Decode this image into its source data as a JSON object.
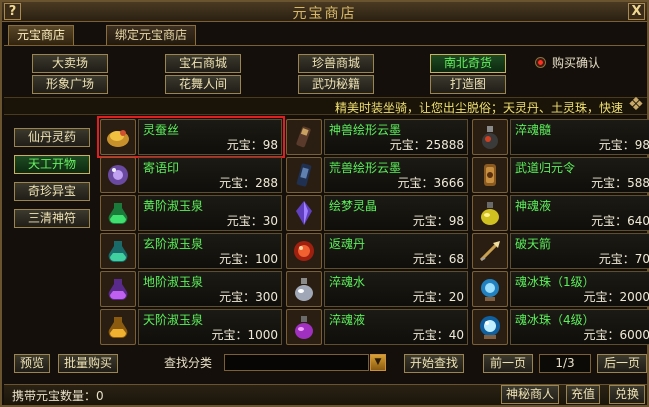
{
  "window": {
    "title": "元宝商店",
    "help_label": "?",
    "close_label": "X"
  },
  "tabs": [
    {
      "label": "元宝商店",
      "active": true
    },
    {
      "label": "绑定元宝商店",
      "active": false
    }
  ],
  "categories": [
    {
      "label": "大卖场",
      "selected": false
    },
    {
      "label": "宝石商城",
      "selected": false
    },
    {
      "label": "珍兽商城",
      "selected": false
    },
    {
      "label": "南北奇货",
      "selected": true
    },
    {
      "label": "形象广场",
      "selected": false
    },
    {
      "label": "花舞人间",
      "selected": false
    },
    {
      "label": "武功秘籍",
      "selected": false
    },
    {
      "label": "打造图",
      "selected": false
    }
  ],
  "buy_confirm": {
    "label": "购买确认",
    "checked": true
  },
  "marquee": "精美时装坐骑，让您出尘脱俗；天灵丹、土灵珠，快速",
  "side_categories": [
    {
      "label": "仙丹灵药",
      "selected": false
    },
    {
      "label": "天工开物",
      "selected": true
    },
    {
      "label": "奇珍异宝",
      "selected": false
    },
    {
      "label": "三清神符",
      "selected": false
    }
  ],
  "price_label": "元宝：",
  "items": [
    {
      "name": "灵蚕丝",
      "price": "98",
      "icon": "silk-icon",
      "highlighted": true
    },
    {
      "name": "神兽绘形云墨",
      "price": "25888",
      "icon": "ink-stick-icon",
      "highlighted": false
    },
    {
      "name": "淬魂髓",
      "price": "98",
      "icon": "bottle-icon",
      "highlighted": false
    },
    {
      "name": "寄语印",
      "price": "288",
      "icon": "seal-icon",
      "highlighted": false
    },
    {
      "name": "荒兽绘形云墨",
      "price": "3666",
      "icon": "ink-block-icon",
      "highlighted": false
    },
    {
      "name": "武道归元令",
      "price": "588",
      "icon": "token-icon",
      "highlighted": false
    },
    {
      "name": "黄阶淑玉泉",
      "price": "30",
      "icon": "green-potion-icon",
      "highlighted": false
    },
    {
      "name": "绘梦灵晶",
      "price": "98",
      "icon": "crystal-icon",
      "highlighted": false
    },
    {
      "name": "神魂液",
      "price": "640",
      "icon": "yellow-flask-icon",
      "highlighted": false
    },
    {
      "name": "玄阶淑玉泉",
      "price": "100",
      "icon": "green-potion-icon",
      "highlighted": false
    },
    {
      "name": "返魂丹",
      "price": "68",
      "icon": "red-pill-icon",
      "highlighted": false
    },
    {
      "name": "破天箭",
      "price": "70",
      "icon": "arrow-icon",
      "highlighted": false
    },
    {
      "name": "地阶淑玉泉",
      "price": "300",
      "icon": "purple-potion-icon",
      "highlighted": false
    },
    {
      "name": "淬魂水",
      "price": "20",
      "icon": "water-flask-icon",
      "highlighted": false
    },
    {
      "name": "魂冰珠（1级）",
      "price": "2000",
      "icon": "ice-orb-icon",
      "highlighted": false
    },
    {
      "name": "天阶淑玉泉",
      "price": "1000",
      "icon": "gold-potion-icon",
      "highlighted": false
    },
    {
      "name": "淬魂液",
      "price": "40",
      "icon": "purple-flask-icon",
      "highlighted": false
    },
    {
      "name": "魂冰珠（4级）",
      "price": "6000",
      "icon": "ice-orb-big-icon",
      "highlighted": false
    }
  ],
  "bottom": {
    "preview_label": "预览",
    "bulk_buy_label": "批量购买",
    "search_label": "查找分类",
    "search_value": "",
    "start_search_label": "开始查找",
    "prev_page_label": "前一页",
    "page": "1/3",
    "next_page_label": "后一页"
  },
  "status": {
    "gold_label": "携带元宝数量：0",
    "mystery_merchant_label": "神秘商人",
    "recharge_label": "充值",
    "exchange_label": "兑换"
  },
  "colors": {
    "item_name": "#5af05a",
    "highlight": "#e02020",
    "border": "#7a6034"
  }
}
